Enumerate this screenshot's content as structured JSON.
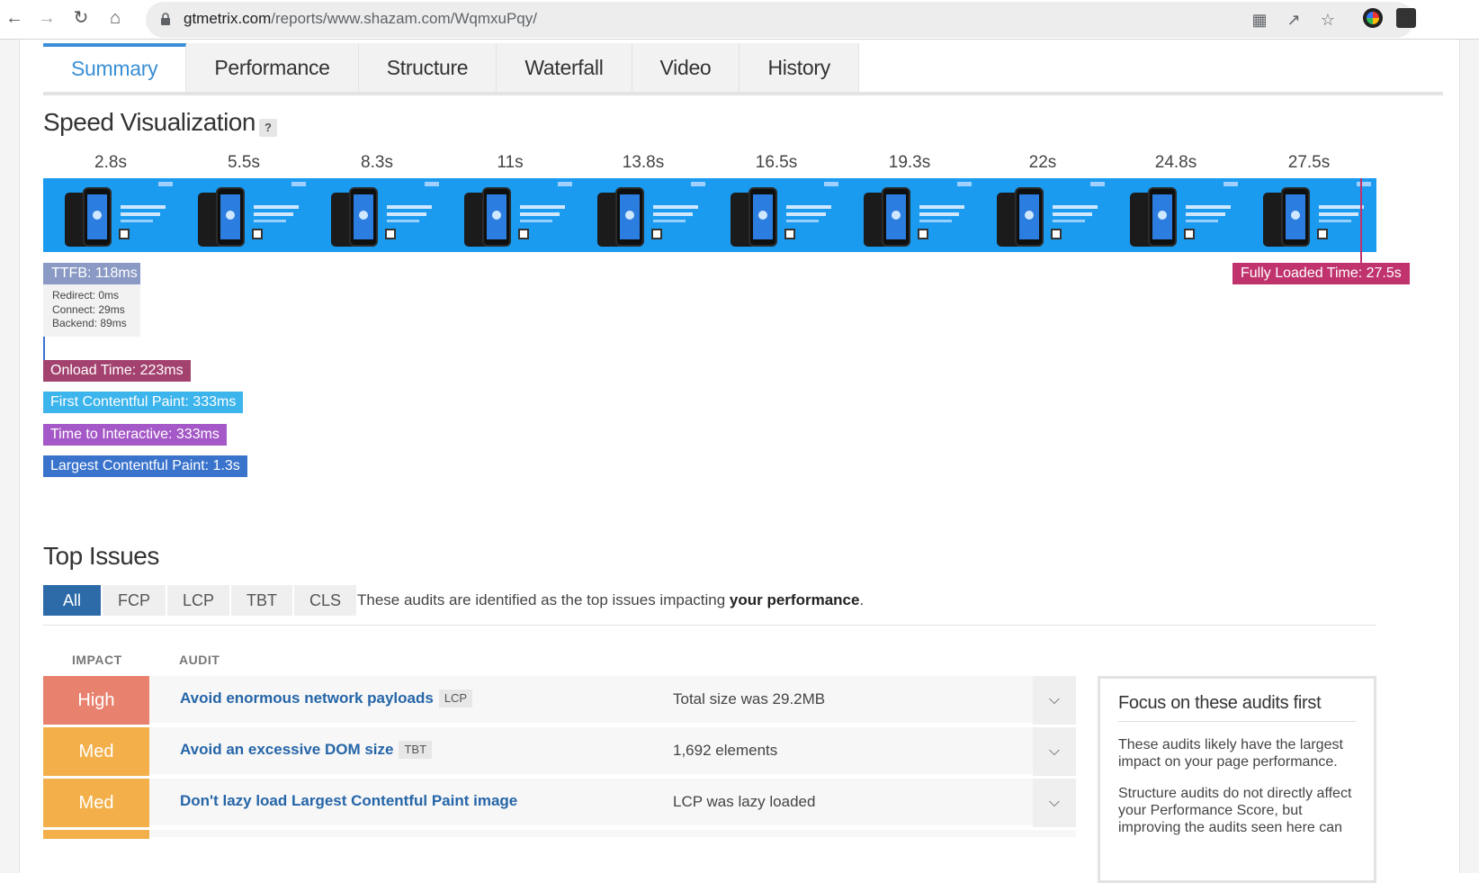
{
  "browser": {
    "url_host": "gtmetrix.com",
    "url_path": "/reports/www.shazam.com/WqmxuPqy/"
  },
  "tabs": [
    "Summary",
    "Performance",
    "Structure",
    "Waterfall",
    "Video",
    "History"
  ],
  "speed_visualization": {
    "title": "Speed Visualization",
    "help": "?",
    "times": [
      "2.8s",
      "5.5s",
      "8.3s",
      "11s",
      "13.8s",
      "16.5s",
      "19.3s",
      "22s",
      "24.8s",
      "27.5s"
    ],
    "ttfb": "TTFB: 118ms",
    "ttfb_details": [
      "Redirect: 0ms",
      "Connect: 29ms",
      "Backend: 89ms"
    ],
    "fully_loaded": "Fully Loaded Time: 27.5s",
    "onload": "Onload Time: 223ms",
    "fcp": "First Contentful Paint: 333ms",
    "tti": "Time to Interactive: 333ms",
    "lcp": "Largest Contentful Paint: 1.3s",
    "colors": {
      "ttfb": "#8a9ac4",
      "fully_loaded": "#c0336d",
      "onload": "#a3426e",
      "fcp": "#3cb4ec",
      "tti": "#a558c7",
      "lcp": "#3a73cc"
    }
  },
  "top_issues": {
    "title": "Top Issues",
    "filters": [
      "All",
      "FCP",
      "LCP",
      "TBT",
      "CLS"
    ],
    "desc_prefix": "These audits are identified as the top issues impacting ",
    "desc_bold": "your performance",
    "desc_suffix": ".",
    "col_impact": "IMPACT",
    "col_audit": "AUDIT",
    "rows": [
      {
        "impact": "High",
        "color": "#e8826f",
        "audit": "Avoid enormous network payloads",
        "tag": "LCP",
        "value": "Total size was 29.2MB"
      },
      {
        "impact": "Med",
        "color": "#f3b04a",
        "audit": "Avoid an excessive DOM size",
        "tag": "TBT",
        "value": "1,692 elements"
      },
      {
        "impact": "Med",
        "color": "#f3b04a",
        "audit": "Don't lazy load Largest Contentful Paint image",
        "tag": "",
        "value": "LCP was lazy loaded"
      }
    ],
    "focus": {
      "title": "Focus on these audits first",
      "p1": "These audits likely have the largest impact on your page performance.",
      "p2": "Structure audits do not directly affect your Performance Score, but improving the audits seen here can"
    }
  }
}
